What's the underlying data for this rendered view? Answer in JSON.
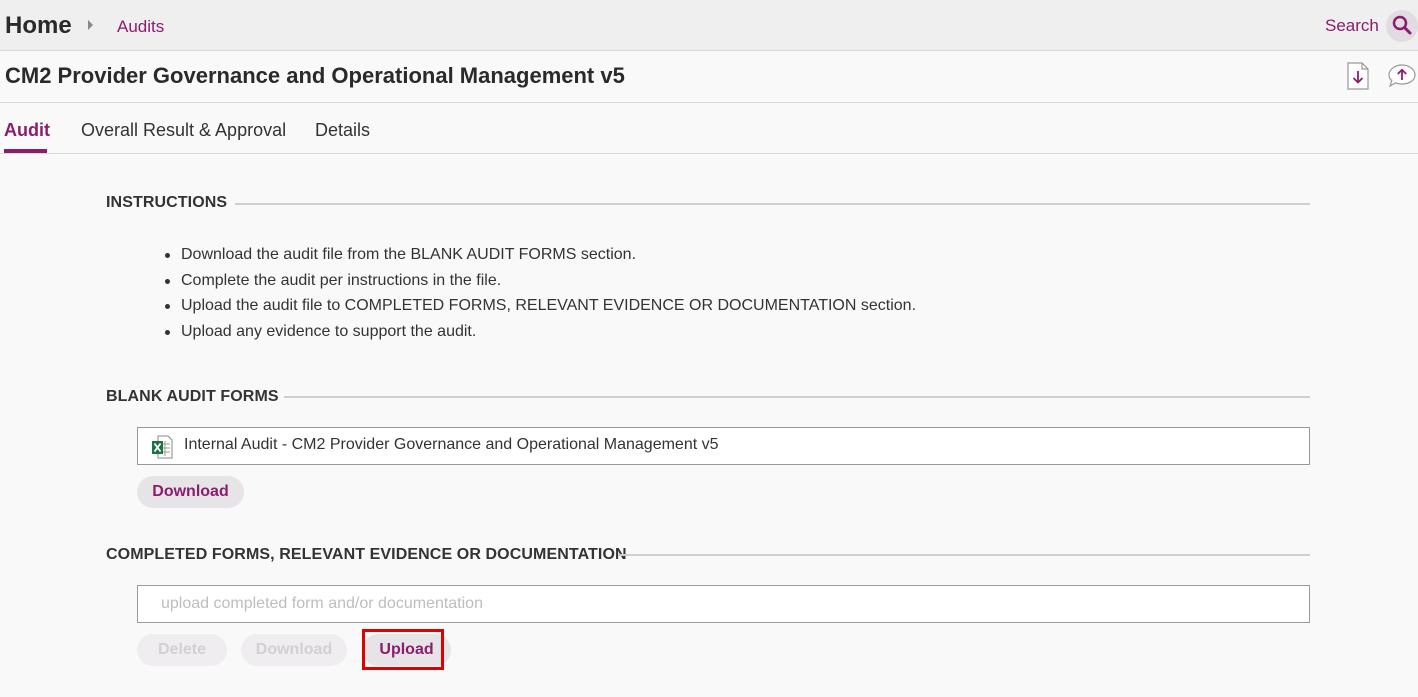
{
  "header": {
    "home_label": "Home",
    "breadcrumb": "Audits",
    "search_label": "Search"
  },
  "page": {
    "title": "CM2 Provider Governance and Operational Management v5"
  },
  "tabs": [
    {
      "label": "Audit",
      "active": true
    },
    {
      "label": "Overall Result & Approval",
      "active": false
    },
    {
      "label": "Details",
      "active": false
    }
  ],
  "instructions": {
    "heading": "INSTRUCTIONS",
    "items": [
      "Download the audit file from the BLANK AUDIT FORMS section.",
      "Complete the audit per instructions in the file.",
      "Upload the audit file to COMPLETED FORMS, RELEVANT EVIDENCE OR DOCUMENTATION section.",
      "Upload any evidence to support the audit."
    ]
  },
  "blank_forms": {
    "heading": "BLANK AUDIT FORMS",
    "file_name": "Internal Audit - CM2 Provider Governance and Operational Management v5",
    "file_icon": "excel-file-icon",
    "download_label": "Download"
  },
  "completed_forms": {
    "heading": "COMPLETED FORMS, RELEVANT EVIDENCE OR DOCUMENTATION",
    "placeholder": "upload completed form and/or documentation",
    "delete_label": "Delete",
    "download_label": "Download",
    "upload_label": "Upload"
  },
  "colors": {
    "accent": "#8b1d6f",
    "highlight": "#e00000",
    "excel_green": "#1f7244"
  }
}
